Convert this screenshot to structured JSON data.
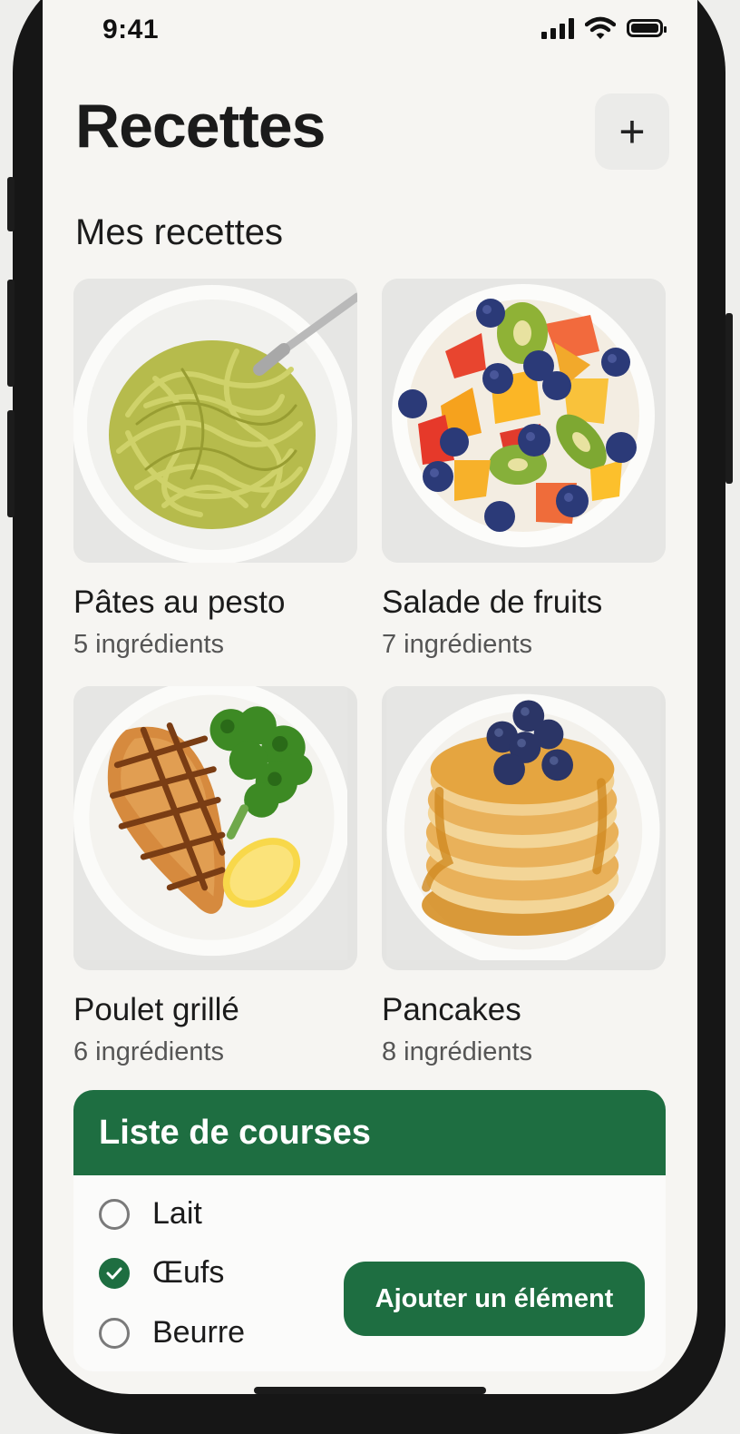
{
  "status_bar": {
    "time": "9:41"
  },
  "header": {
    "title": "Recettes",
    "add_icon": "plus-icon",
    "add_label": "+"
  },
  "section": {
    "title": "Mes recettes"
  },
  "recipes": [
    {
      "name": "Pâtes au pesto",
      "count": "5 ingrédients",
      "image": "pesto-pasta-photo"
    },
    {
      "name": "Salade de fruits",
      "count": "7 ingrédients",
      "image": "fruit-salad-photo"
    },
    {
      "name": "Poulet grillé",
      "count": "6 ingrédients",
      "image": "grilled-chicken-photo"
    },
    {
      "name": "Pancakes",
      "count": "8 ingrédients",
      "image": "pancakes-photo"
    }
  ],
  "shopping": {
    "title": "Liste de courses",
    "items": [
      {
        "label": "Lait",
        "checked": false
      },
      {
        "label": "Œufs",
        "checked": true
      },
      {
        "label": "Beurre",
        "checked": false
      }
    ],
    "add_button": "Ajouter un élément"
  },
  "colors": {
    "accent": "#1e6e41",
    "background": "#f6f5f2"
  }
}
